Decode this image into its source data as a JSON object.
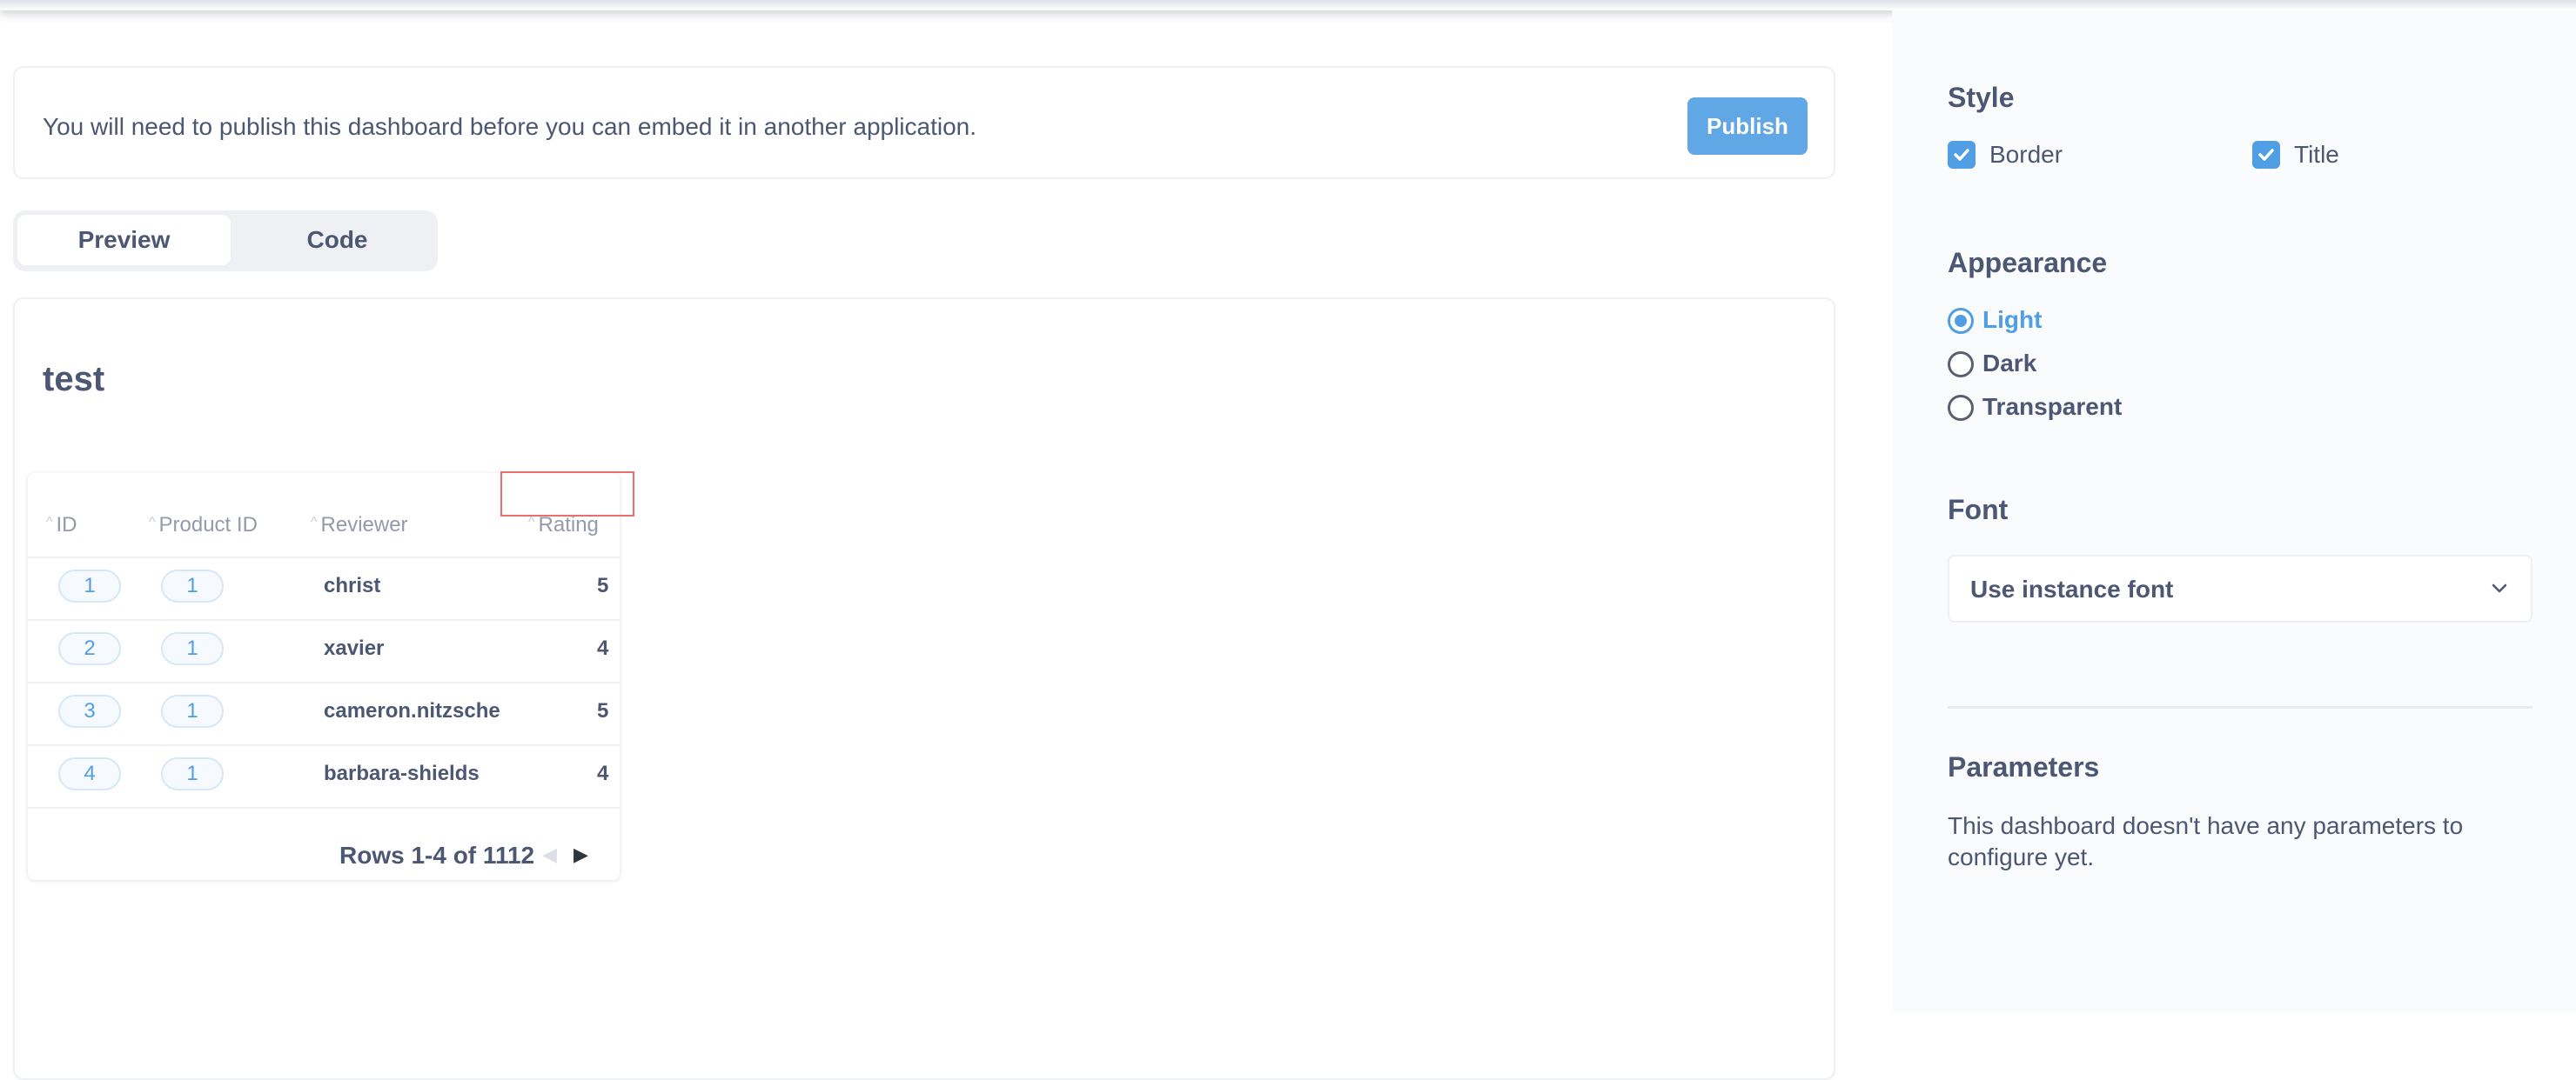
{
  "notice": {
    "text": "You will need to publish this dashboard before you can embed it in another application.",
    "publish_label": "Publish"
  },
  "tabs": [
    {
      "label": "Preview",
      "active": true
    },
    {
      "label": "Code",
      "active": false
    }
  ],
  "dashboard": {
    "title": "test",
    "table": {
      "columns": [
        "ID",
        "Product ID",
        "Reviewer",
        "Rating"
      ],
      "rows": [
        {
          "id": "1",
          "product_id": "1",
          "reviewer": "christ",
          "rating": "5"
        },
        {
          "id": "2",
          "product_id": "1",
          "reviewer": "xavier",
          "rating": "4"
        },
        {
          "id": "3",
          "product_id": "1",
          "reviewer": "cameron.nitzsche",
          "rating": "5"
        },
        {
          "id": "4",
          "product_id": "1",
          "reviewer": "barbara-shields",
          "rating": "4"
        }
      ],
      "footer": "Rows 1-4 of 1112"
    }
  },
  "sidebar": {
    "style": {
      "title": "Style",
      "border_label": "Border",
      "border_checked": true,
      "title_label": "Title",
      "title_checked": true
    },
    "appearance": {
      "title": "Appearance",
      "options": [
        "Light",
        "Dark",
        "Transparent"
      ],
      "selected": "Light"
    },
    "font": {
      "title": "Font",
      "value": "Use instance font"
    },
    "parameters": {
      "title": "Parameters",
      "text": "This dashboard doesn't have any parameters to configure yet."
    }
  },
  "colors": {
    "accent": "#509ee3",
    "text": "#4c5773",
    "muted": "#949aab",
    "highlight": "#ed6e6e"
  }
}
